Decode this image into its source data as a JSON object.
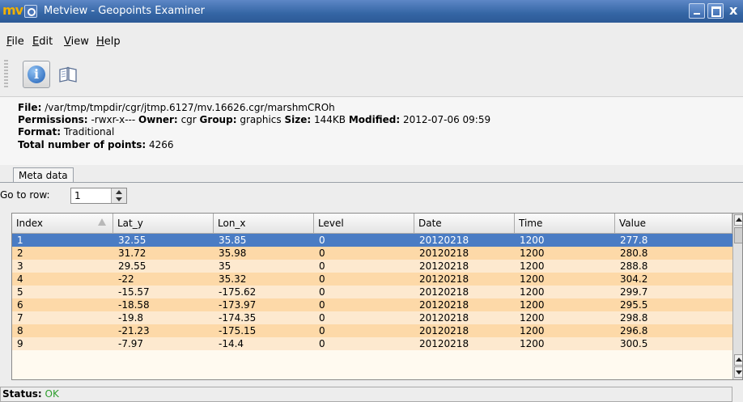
{
  "window": {
    "title": "Metview - Geopoints Examiner",
    "logo_text": "mv",
    "close_glyph": "x",
    "accent_color": "#3465a4"
  },
  "menu": {
    "items": [
      {
        "label": "File"
      },
      {
        "label": "Edit"
      },
      {
        "label": "View"
      },
      {
        "label": "Help"
      }
    ]
  },
  "toolbar": {
    "info_icon": "info-icon",
    "book_icon": "book-icon"
  },
  "info": {
    "file_label": "File:",
    "file_value": "/var/tmp/tmpdir/cgr/jtmp.6127/mv.16626.cgr/marshmCROh",
    "permissions_label": "Permissions:",
    "permissions_value": "-rwxr-x---",
    "owner_label": "Owner:",
    "owner_value": "cgr",
    "group_label": "Group:",
    "group_value": "graphics",
    "size_label": "Size:",
    "size_value": "144KB",
    "modified_label": "Modified:",
    "modified_value": "2012-07-06 09:59",
    "format_label": "Format:",
    "format_value": "Traditional",
    "total_label": "Total number of points:",
    "total_value": "4266"
  },
  "tabs": [
    {
      "label": "Meta data"
    }
  ],
  "goto": {
    "label": "Go to row:",
    "value": "1"
  },
  "table": {
    "columns": [
      "Index",
      "Lat_y",
      "Lon_x",
      "Level",
      "Date",
      "Time",
      "Value"
    ],
    "rows": [
      [
        "1",
        "32.55",
        "35.85",
        "0",
        "20120218",
        "1200",
        "277.8"
      ],
      [
        "2",
        "31.72",
        "35.98",
        "0",
        "20120218",
        "1200",
        "280.8"
      ],
      [
        "3",
        "29.55",
        "35",
        "0",
        "20120218",
        "1200",
        "288.8"
      ],
      [
        "4",
        "-22",
        "35.32",
        "0",
        "20120218",
        "1200",
        "304.2"
      ],
      [
        "5",
        "-15.57",
        "-175.62",
        "0",
        "20120218",
        "1200",
        "299.7"
      ],
      [
        "6",
        "-18.58",
        "-173.97",
        "0",
        "20120218",
        "1200",
        "295.5"
      ],
      [
        "7",
        "-19.8",
        "-174.35",
        "0",
        "20120218",
        "1200",
        "298.8"
      ],
      [
        "8",
        "-21.23",
        "-175.15",
        "0",
        "20120218",
        "1200",
        "296.8"
      ],
      [
        "9",
        "-7.97",
        "-14.4",
        "0",
        "20120218",
        "1200",
        "300.5"
      ]
    ],
    "selected_row": 0,
    "selected_color": "#4a7cc4",
    "row_colors": [
      "#fde9cf",
      "#fdd9a8"
    ]
  },
  "status": {
    "label": "Status:",
    "value": "OK",
    "value_color": "#2e9e2e"
  }
}
